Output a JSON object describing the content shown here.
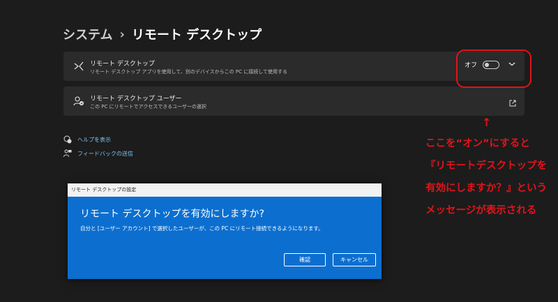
{
  "breadcrumb": {
    "parent": "システム",
    "separator": "›",
    "current": "リモート デスクトップ"
  },
  "remote_desktop": {
    "title": "リモート デスクトップ",
    "description": "リモート デスクトップ アプリを使用して、別のデバイスからこの PC に接続して使用する",
    "toggle_state_label": "オフ",
    "toggle_on": false
  },
  "remote_users": {
    "title": "リモート デスクトップ ユーザー",
    "description": "この PC にリモートでアクセスできるユーザーの選択"
  },
  "links": [
    {
      "label": "ヘルプを表示",
      "icon": "help-icon"
    },
    {
      "label": "フィードバックの送信",
      "icon": "feedback-icon"
    }
  ],
  "annotation": {
    "arrow": "↑",
    "text": "ここを“オン”にすると\n『リモートデスクトップを有効にしますか？』というメッセージが表示される",
    "color": "#e0141a"
  },
  "dialog": {
    "title": "リモート デスクトップの設定",
    "heading": "リモート デスクトップを有効にしますか?",
    "message": "自分と [ユーザー アカウント] で選択したユーザーが、この PC にリモート接続できるようになります。",
    "confirm_label": "確認",
    "cancel_label": "キャンセル",
    "accent": "#0c6fd0"
  }
}
